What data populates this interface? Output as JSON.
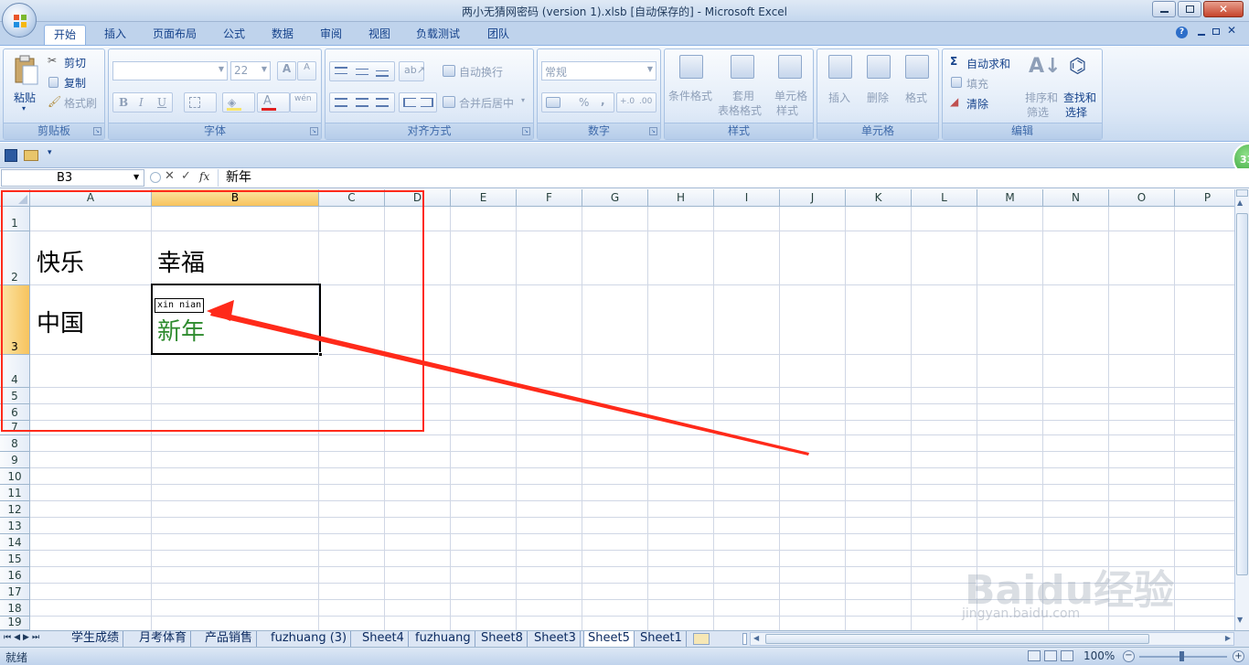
{
  "window": {
    "title": "两小无猜网密码 (version 1).xlsb [自动保存的] - Microsoft Excel"
  },
  "tabs": [
    "开始",
    "插入",
    "页面布局",
    "公式",
    "数据",
    "审阅",
    "视图",
    "负载测试",
    "团队"
  ],
  "active_tab": "开始",
  "ribbon": {
    "clipboard": {
      "label": "剪贴板",
      "paste": "粘贴",
      "cut": "剪切",
      "copy": "复制",
      "format_painter": "格式刷"
    },
    "font": {
      "label": "字体",
      "size": "22",
      "bold": "B",
      "italic": "I",
      "underline": "U",
      "grow": "A",
      "shrink": "A"
    },
    "alignment": {
      "label": "对齐方式",
      "wrap": "自动换行",
      "merge": "合并后居中"
    },
    "number": {
      "label": "数字",
      "format": "常规",
      "percent": "%",
      "comma": ","
    },
    "styles": {
      "label": "样式",
      "conditional": "条件格式",
      "table_format_1": "套用",
      "table_format_2": "表格格式",
      "cell_styles_1": "单元格",
      "cell_styles_2": "样式"
    },
    "cells": {
      "label": "单元格",
      "insert": "插入",
      "delete": "删除",
      "format": "格式"
    },
    "editing": {
      "label": "编辑",
      "autosum": "自动求和",
      "fill": "填充",
      "clear": "清除",
      "sort_1": "排序和",
      "sort_2": "筛选",
      "find_1": "查找和",
      "find_2": "选择"
    }
  },
  "formula_bar": {
    "name_box": "B3",
    "content": "新年",
    "fx": "fx"
  },
  "columns": [
    "A",
    "B",
    "C",
    "D",
    "E",
    "F",
    "G",
    "H",
    "I",
    "J",
    "K",
    "L",
    "M",
    "N",
    "O",
    "P"
  ],
  "rows": [
    "1",
    "2",
    "3",
    "4",
    "5",
    "6",
    "7",
    "8",
    "9",
    "10",
    "11",
    "12",
    "13",
    "14",
    "15",
    "16",
    "17",
    "18",
    "19"
  ],
  "cells": {
    "A2": "快乐",
    "B2": "幸福",
    "A3": "中国",
    "B3": "新年",
    "B3_phonetic": "xin nian"
  },
  "sheet_tabs": [
    "学生成绩",
    "月考体育",
    "产品销售",
    "fuzhuang (3)",
    "Sheet4",
    "fuzhuang",
    "Sheet8",
    "Sheet3",
    "Sheet5",
    "Sheet1"
  ],
  "active_sheet": "Sheet5",
  "status": {
    "ready": "就绪",
    "zoom": "100%"
  },
  "side_badge": "33",
  "watermark": {
    "brand": "Baidu经验",
    "url": "jingyan.baidu.com"
  },
  "colors": {
    "annotation_red": "#ff2a1a",
    "phonetic_green": "#2e8b2e",
    "selected_header": "#f7c35e"
  }
}
